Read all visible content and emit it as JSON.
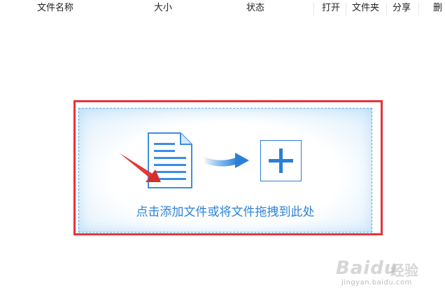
{
  "columns": {
    "name": "文件名称",
    "size": "大小",
    "status": "状态",
    "open": "打开",
    "folder": "文件夹",
    "share": "分享",
    "delete": "删"
  },
  "dropzone": {
    "hint": "点击添加文件或将文件拖拽到此处"
  },
  "watermark": {
    "brand": "Baidu",
    "brand_cn": "经验",
    "url": "jingyan.baidu.com"
  },
  "colors": {
    "accent": "#2b7fd8",
    "highlight_border": "#e8333a",
    "dashed_border": "#5aa9e6"
  },
  "icons": [
    "document-icon",
    "arrow-right-icon",
    "plus-icon",
    "red-pointer-arrow-icon"
  ]
}
